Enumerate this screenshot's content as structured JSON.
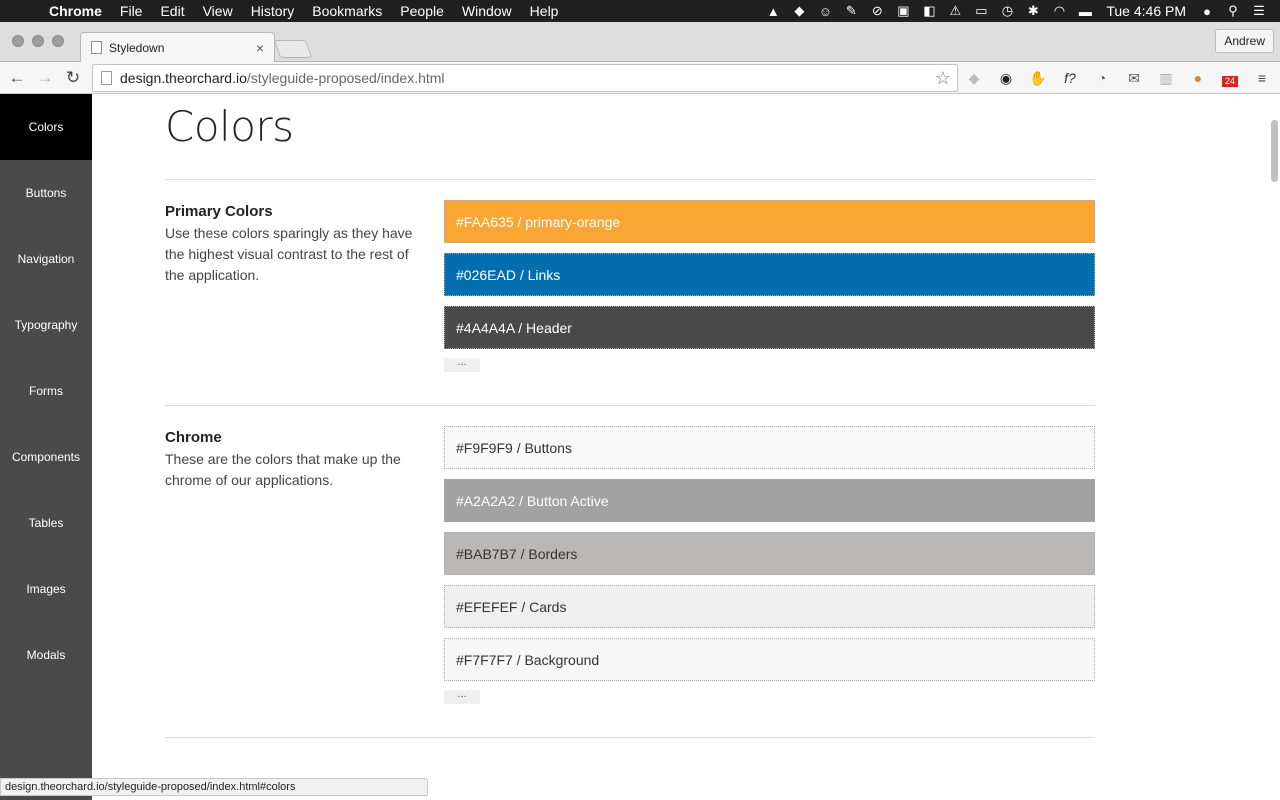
{
  "menubar": {
    "app_name": "Chrome",
    "menus": [
      "File",
      "Edit",
      "View",
      "History",
      "Bookmarks",
      "People",
      "Window",
      "Help"
    ],
    "clock": "Tue 4:46 PM"
  },
  "browser": {
    "tab_title": "Styledown",
    "profile_name": "Andrew",
    "url_host": "design.theorchard.io",
    "url_path": "/styleguide-proposed/index.html",
    "status_url": "design.theorchard.io/styleguide-proposed/index.html#colors",
    "extension_badge": "24"
  },
  "sidebar": {
    "items": [
      {
        "label": "Colors",
        "active": true
      },
      {
        "label": "Buttons",
        "active": false
      },
      {
        "label": "Navigation",
        "active": false
      },
      {
        "label": "Typography",
        "active": false
      },
      {
        "label": "Forms",
        "active": false
      },
      {
        "label": "Components",
        "active": false
      },
      {
        "label": "Tables",
        "active": false
      },
      {
        "label": "Images",
        "active": false
      },
      {
        "label": "Modals",
        "active": false
      }
    ]
  },
  "page": {
    "title": "Colors",
    "sections": [
      {
        "title": "Primary Colors",
        "description": "Use these colors sparingly as they have the highest visual contrast to the rest of the application.",
        "swatches": [
          {
            "label": "#FAA635 / primary-orange",
            "color": "#FAA635",
            "text_color": "#ffffff"
          },
          {
            "label": "#026EAD / Links",
            "color": "#026EAD",
            "text_color": "#ffffff"
          },
          {
            "label": "#4A4A4A / Header",
            "color": "#4A4A4A",
            "text_color": "#ffffff"
          }
        ],
        "more": "..."
      },
      {
        "title": "Chrome",
        "description": "These are the colors that make up the chrome of our applications.",
        "swatches": [
          {
            "label": "#F9F9F9 / Buttons",
            "color": "#F9F9F9",
            "text_color": "#333333"
          },
          {
            "label": "#A2A2A2 / Button Active",
            "color": "#A2A2A2",
            "text_color": "#ffffff"
          },
          {
            "label": "#BAB7B7 / Borders",
            "color": "#BAB7B7",
            "text_color": "#333333"
          },
          {
            "label": "#EFEFEF / Cards",
            "color": "#EFEFEF",
            "text_color": "#333333"
          },
          {
            "label": "#F7F7F7 / Background",
            "color": "#F7F7F7",
            "text_color": "#333333"
          }
        ],
        "more": "..."
      }
    ]
  }
}
